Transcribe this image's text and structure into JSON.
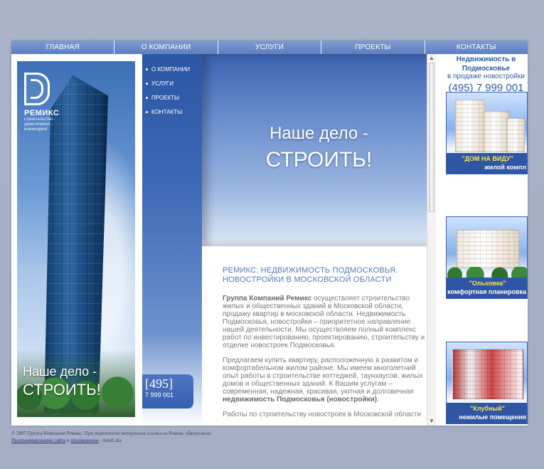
{
  "topnav": {
    "items": [
      {
        "label": "ГЛАВНАЯ"
      },
      {
        "label": "О КОМПАНИИ"
      },
      {
        "label": "УСЛУГИ"
      },
      {
        "label": "ПРОЕКТЫ"
      },
      {
        "label": "КОНТАКТЫ"
      }
    ]
  },
  "sidebar": {
    "items": [
      {
        "label": "О КОМПАНИИ"
      },
      {
        "label": "УСЛУГИ"
      },
      {
        "label": "ПРОЕКТЫ"
      },
      {
        "label": "КОНТАКТЫ"
      }
    ],
    "phone_code": "[495]",
    "phone_number": "7 999 001"
  },
  "brand": {
    "name": "РЕМИКС",
    "subtitle": "строительство · девелопмент · инжиниринг"
  },
  "hero_left": {
    "line1": "Наше дело -",
    "line2": "СТРОИТЬ!"
  },
  "hero_main": {
    "line1": "Наше дело -",
    "line2": "СТРОИТЬ!"
  },
  "content": {
    "title": "РЕМИКС: НЕДВИЖИМОСТЬ ПОДМОСКОВЬЯ. НОВОСТРОЙКИ В МОСКОВСКОЙ ОБЛАСТИ",
    "p1_strong": "Группа Компаний Ремикс",
    "p1_rest": " осуществляет строительство жилых и общественных зданий в Московской области, продажу квартир в московской области. Недвижимость Подмосковья, новостройки – приоритетное направление нашей деятельности. Мы осуществляем полный комплекс работ по инвестированию, проектированию, строительству и отделке новостроек Подмосковья.",
    "p2_start": "Предлагаем купить квартиру, расположенную в развитом и комфортабельном жилом районе. Мы имеем многолетний опыт работы в строительстве коттеджей, таунхаусов, жилых домов и общественных зданий. К Вашим услугам – современная, надежная, красивая, уютная и долговечная ",
    "p2_strong": "недвижимость Подмосковья (новостройки)",
    "p2_end": ".",
    "p3": "Работы по строительству новостроек в Московской области"
  },
  "right": {
    "title1": "Недвижимость в",
    "title2": "Подмосковье",
    "subtitle": "в продаже новостройки",
    "phone": "(495) 7 999 001",
    "ads": [
      {
        "name": "\"ДОМ НА ВИДУ\"",
        "desc": "жилой компл"
      },
      {
        "name": "\"Ольховка\"",
        "desc": "комфортная планировка"
      },
      {
        "name": "\"Клубный\"",
        "desc": "нежилые помещения"
      }
    ]
  },
  "footer": {
    "line1": "© 2007 Группа Компаний Ремикс. При перепечатке материалов ссылка на Ремикс обязательна.",
    "link1": "Программирование сайта",
    "mid": " и ",
    "link2": "продвижение",
    "end": " - IntelLabs"
  },
  "colors": {
    "page_bg": "#a9b3c7",
    "brand_blue": "#2f5da8",
    "nav_blue": "#5f7fbf",
    "accent_yellow": "#ffe34d"
  }
}
